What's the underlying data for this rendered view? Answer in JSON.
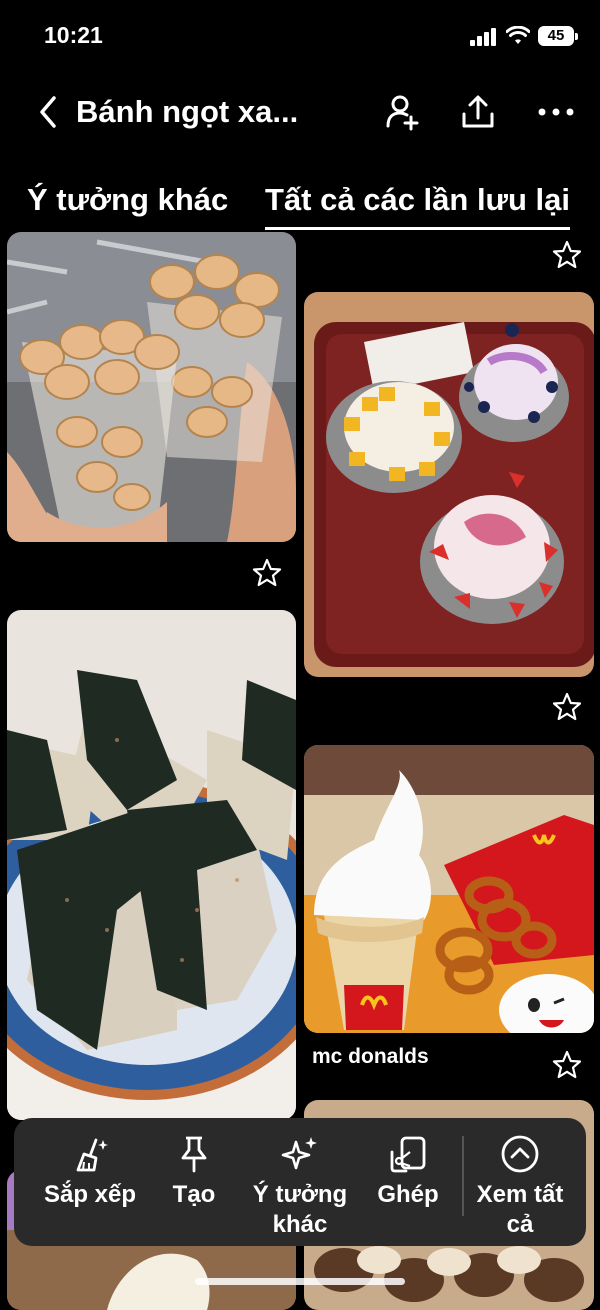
{
  "status": {
    "time": "10:21",
    "battery": "45"
  },
  "header": {
    "title": "Bánh ngọt xa..."
  },
  "tabs": [
    {
      "label": "Ý tưởng khác",
      "active": false
    },
    {
      "label": "Tất cả các lần lưu lại",
      "active": true
    }
  ],
  "pins": [
    {
      "description": "dumplings in cups"
    },
    {
      "description": "fruit shaved ice bowls"
    },
    {
      "description": "onigiri rice balls"
    },
    {
      "description": "mcdonalds ice cream and onion rings",
      "caption": "mc donalds"
    }
  ],
  "toolbar": {
    "items": [
      {
        "label": "Sắp xếp",
        "icon": "broom-sparkle-icon"
      },
      {
        "label": "Tạo",
        "icon": "pin-icon"
      },
      {
        "label_line1": "Ý tưởng",
        "label_line2": "khác",
        "icon": "sparkle-icon"
      },
      {
        "label": "Ghép",
        "icon": "cut-collage-icon"
      },
      {
        "label_line1": "Xem tất",
        "label_line2": "cả",
        "icon": "chevron-up-circle-icon"
      }
    ]
  }
}
